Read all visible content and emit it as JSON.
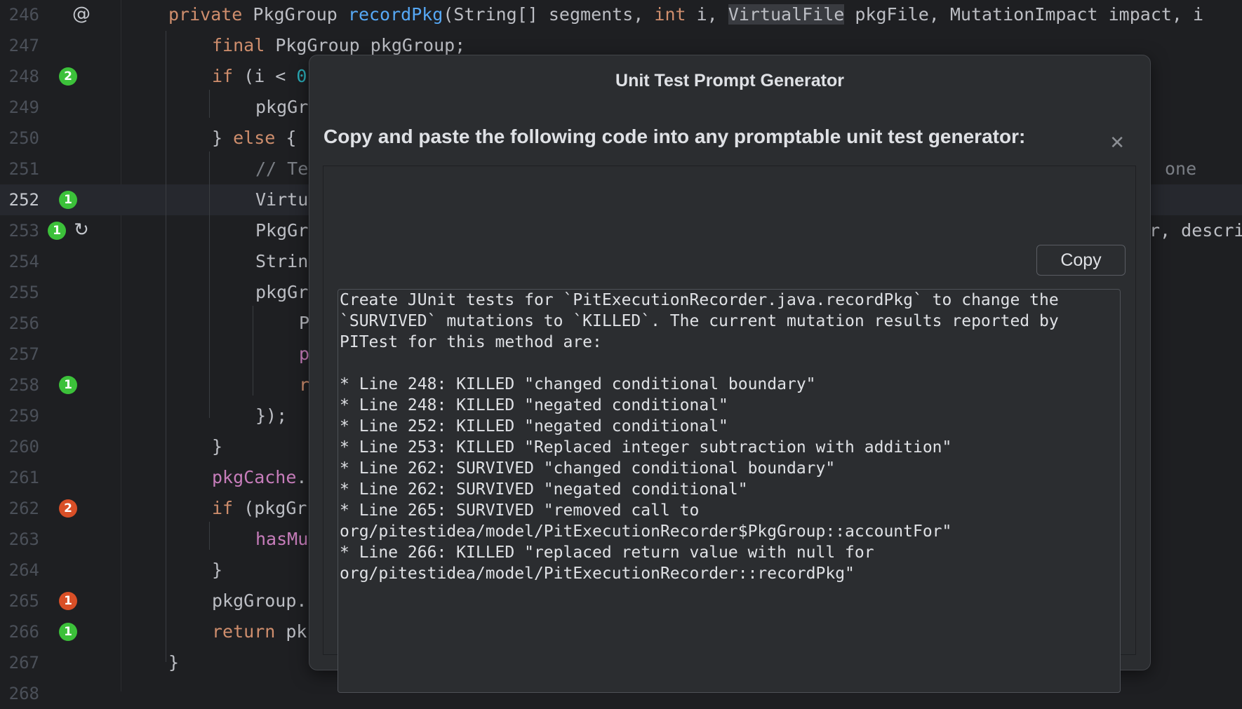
{
  "editor": {
    "lines": [
      {
        "num": "246",
        "gutter_icon": "at-sign-icon",
        "code": [
          {
            "t": "private ",
            "c": "kw"
          },
          {
            "t": "PkgGroup "
          },
          {
            "t": "recordPkg",
            "c": "fn"
          },
          {
            "t": "(String[] segments, "
          },
          {
            "t": "int ",
            "c": "kw"
          },
          {
            "t": "i, "
          },
          {
            "t": "VirtualFile",
            "c": "hl"
          },
          {
            "t": " pkgFile, MutationImpact impact, i"
          }
        ]
      },
      {
        "num": "247",
        "code": [
          {
            "t": "final ",
            "c": "kw"
          },
          {
            "t": "PkgGroup pkgGroup;"
          }
        ]
      },
      {
        "num": "248",
        "badge": {
          "count": "2",
          "color": "green"
        },
        "code": [
          {
            "t": "if ",
            "c": "kw"
          },
          {
            "t": "(i < "
          },
          {
            "t": "0",
            "c": "num"
          }
        ]
      },
      {
        "num": "249",
        "code": [
          {
            "t": "pkgGr"
          }
        ]
      },
      {
        "num": "250",
        "code": [
          {
            "t": "} "
          },
          {
            "t": "else ",
            "c": "kw"
          },
          {
            "t": "{"
          }
        ]
      },
      {
        "num": "251",
        "code": [
          {
            "t": "// Te",
            "c": "cmt"
          }
        ],
        "right": {
          "t": "one",
          "c": "cmt"
        }
      },
      {
        "num": "252",
        "current": true,
        "badge": {
          "count": "1",
          "color": "green"
        },
        "code": [
          {
            "t": "Virtu"
          }
        ]
      },
      {
        "num": "253",
        "badge": {
          "count": "1",
          "color": "green"
        },
        "gutter_icon": "rerun-icon",
        "code": [
          {
            "t": "PkgGr"
          }
        ],
        "right": {
          "t": "r, descri"
        }
      },
      {
        "num": "254",
        "code": [
          {
            "t": "Strin"
          }
        ]
      },
      {
        "num": "255",
        "code": [
          {
            "t": "pkgGr"
          }
        ]
      },
      {
        "num": "256",
        "code": [
          {
            "t": "P"
          }
        ]
      },
      {
        "num": "257",
        "code": [
          {
            "t": "p",
            "c": "fld"
          }
        ]
      },
      {
        "num": "258",
        "badge": {
          "count": "1",
          "color": "green"
        },
        "code": [
          {
            "t": "r",
            "c": "kw"
          }
        ]
      },
      {
        "num": "259",
        "code": [
          {
            "t": "});"
          }
        ]
      },
      {
        "num": "260",
        "code": [
          {
            "t": "}"
          }
        ]
      },
      {
        "num": "261",
        "code": [
          {
            "t": "pkgCache",
            "c": "fld"
          },
          {
            "t": "."
          }
        ]
      },
      {
        "num": "262",
        "badge": {
          "count": "2",
          "color": "red"
        },
        "code": [
          {
            "t": "if ",
            "c": "kw"
          },
          {
            "t": "(pkgGr"
          }
        ]
      },
      {
        "num": "263",
        "code": [
          {
            "t": "hasMu",
            "c": "fld"
          }
        ]
      },
      {
        "num": "264",
        "code": [
          {
            "t": "}"
          }
        ]
      },
      {
        "num": "265",
        "badge": {
          "count": "1",
          "color": "red"
        },
        "code": [
          {
            "t": "pkgGroup."
          }
        ]
      },
      {
        "num": "266",
        "badge": {
          "count": "1",
          "color": "green"
        },
        "code": [
          {
            "t": "return ",
            "c": "kw"
          },
          {
            "t": "pk"
          }
        ]
      },
      {
        "num": "267",
        "code": [
          {
            "t": "}"
          }
        ]
      },
      {
        "num": "268",
        "code": []
      }
    ]
  },
  "dialog": {
    "title": "Unit Test Prompt Generator",
    "subtitle": "Copy and paste the following code into any promptable unit test generator:",
    "close_icon": "close-icon",
    "copy_label": "Copy",
    "prompt_text": "Create JUnit tests for `PitExecutionRecorder.java.recordPkg` to change the\n`SURVIVED` mutations to `KILLED`. The current mutation results reported by\nPITest for this method are:\n\n* Line 248: KILLED \"changed conditional boundary\"\n* Line 248: KILLED \"negated conditional\"\n* Line 252: KILLED \"negated conditional\"\n* Line 253: KILLED \"Replaced integer subtraction with addition\"\n* Line 262: SURVIVED \"changed conditional boundary\"\n* Line 262: SURVIVED \"negated conditional\"\n* Line 265: SURVIVED \"removed call to\norg/pitestidea/model/PitExecutionRecorder$PkgGroup::accountFor\"\n* Line 266: KILLED \"replaced return value with null for\norg/pitestidea/model/PitExecutionRecorder::recordPkg\""
  },
  "colors": {
    "editor_bg": "#1e1f22",
    "dialog_bg": "#2b2d30",
    "keyword": "#cf8e6d",
    "function": "#56a8f5",
    "field": "#c77dbb",
    "killed_badge": "#3cc13a",
    "survived_badge": "#d94f27"
  }
}
